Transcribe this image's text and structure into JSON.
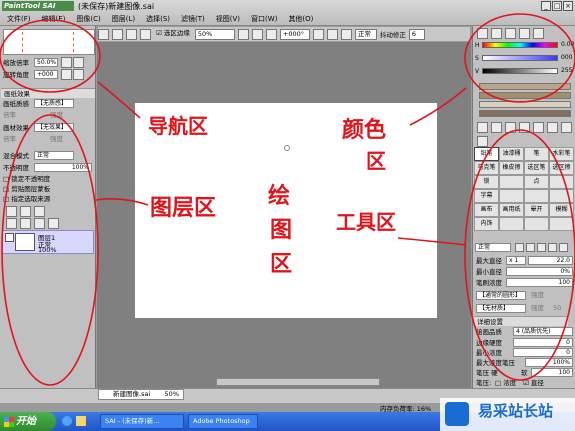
{
  "app": {
    "logo": "PaintTool SAI",
    "title": "(未保存)新建图像.sai"
  },
  "menu": [
    "文件(F)",
    "编辑(E)",
    "图像(C)",
    "图层(L)",
    "选择(S)",
    "滤镜(T)",
    "视图(V)",
    "窗口(W)",
    "其他(O)"
  ],
  "toolbar": {
    "selection_edge": "选区边缘",
    "zoom": "50%",
    "rotation": "+000°",
    "mode": "正常",
    "stabilizer_label": "抖动修正",
    "stabilizer_value": "6"
  },
  "navigator": {
    "zoom_label": "缩放倍率",
    "zoom_value": "50.0%",
    "rotate_label": "旋转角度",
    "rotate_value": "+000"
  },
  "paper": {
    "section": "画纸效果",
    "texture_label": "画纸质感",
    "texture_value": "【无质感】",
    "effect_label": "画材效果",
    "effect_value": "【无效果】",
    "scale_label": "倍率",
    "strength_label": "强度"
  },
  "layers": {
    "blend_label": "混合模式",
    "blend_value": "正常",
    "opacity_label": "不透明度",
    "opacity_value": "100%",
    "check1": "锁定不透明度",
    "check2": "剪贴图层蒙板",
    "check3": "指定选取来源",
    "layer_name": "图层1",
    "layer_mode": "正常",
    "layer_opacity": "100%"
  },
  "color": {
    "h": "0",
    "s": "000",
    "v": "255",
    "k_value": "0.00"
  },
  "tools": [
    "铅笔",
    "油漆桶",
    "笔",
    "水彩笔",
    "马克笔",
    "橡皮擦",
    "选区笔",
    "选区擦",
    "锁",
    "",
    "点",
    "",
    "字幕",
    "",
    "",
    "",
    "画布",
    "画用纸",
    "晕开",
    "模糊",
    "内饰",
    "",
    "",
    ""
  ],
  "brush": {
    "mode": "正常",
    "max_diameter_label": "最大直径",
    "max_diameter_mult": "x 1",
    "max_diameter_value": "22.0",
    "min_diameter_label": "最小直径",
    "min_diameter_value": "0%",
    "density_label": "笔刷浓度",
    "density_value": "100",
    "shape": "【通常的圆形】",
    "texture": "【无材质】",
    "strength_label": "强度",
    "strength_value": "50",
    "adv_section": "详细设置",
    "quality_label": "绘画品质",
    "quality_value": "4 (品质优先)",
    "edge_label": "边缘硬度",
    "edge_value": "0",
    "min_density_label": "最小浓度",
    "min_density_value": "0",
    "max_pressure_label": "最大浓度笔压",
    "max_pressure_value": "100%",
    "hardness_label": "笔压 硬",
    "softness_label": "软",
    "hardness_value": "100",
    "pressure_label": "笔压:",
    "pressure_density": "浓度",
    "pressure_diameter": "直径"
  },
  "status": {
    "doc_tab": "新建图像.sai",
    "doc_zoom": "50%",
    "memory": "内存负荷率: 16%"
  },
  "taskbar": {
    "start": "开始",
    "task1": "SAI - (未保存)新...",
    "task2": "Adobe Photoshop"
  },
  "annotations": {
    "nav": "导航区",
    "layers": "图层区",
    "draw1": "绘",
    "draw2": "图",
    "draw3": "区",
    "color1": "颜色",
    "color2": "区",
    "tools": "工具区"
  },
  "watermark": "易采站长站",
  "colors": {
    "annotation_red": "#e0141b",
    "xp_blue": "#245edb",
    "layer_select": "#d7d7ff"
  }
}
